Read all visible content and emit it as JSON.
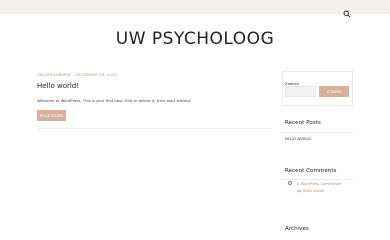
{
  "site": {
    "title": "UW PSYCHOLOOG"
  },
  "post": {
    "category": "UNCATEGORIZED",
    "date": "DECEMBER 23, 2022",
    "title": "Hello world!",
    "excerpt": "Welcome to WordPress. This is your first post. Edit or delete it, then start writing!",
    "read_more": "READ MORE"
  },
  "sidebar": {
    "search": {
      "label": "Zoeken",
      "button": "ZOEKEN",
      "value": ""
    },
    "recent_posts": {
      "title": "Recent Posts",
      "items": [
        "Hello world!"
      ]
    },
    "recent_comments": {
      "title": "Recent Comments",
      "items": [
        {
          "author": "A WordPress Commenter",
          "on": "op",
          "post": "Hello world!"
        }
      ]
    },
    "archives": {
      "title": "Archives"
    }
  },
  "colors": {
    "accent": "#d8b19b",
    "meta": "#b08d6f",
    "topbar": "#f4f0ed"
  },
  "icons": {
    "topbar_search": "search-icon"
  }
}
